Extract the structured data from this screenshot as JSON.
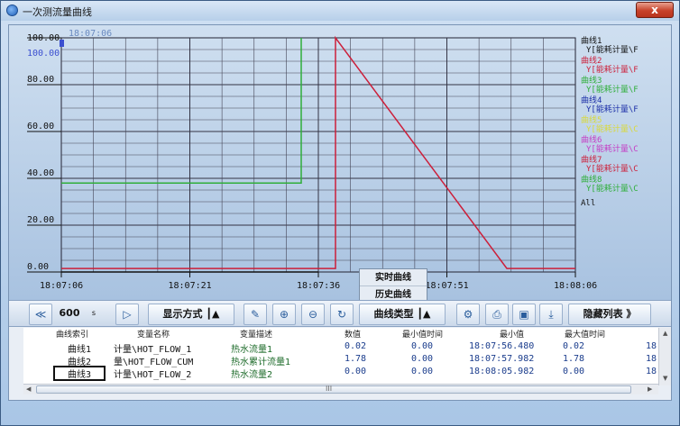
{
  "window": {
    "title": "一次测流量曲线",
    "close_label": "x"
  },
  "chart": {
    "y_ticks": [
      "100.00",
      "80.00",
      "60.00",
      "40.00",
      "20.00",
      "0.00"
    ],
    "y_max_label": "100.00",
    "cursor_time": "18:07:06",
    "x_ticks": [
      "18:07:06",
      "18:07:21",
      "18:07:36",
      "18:07:51",
      "18:08:06"
    ],
    "legend": [
      {
        "name": "曲线1",
        "var": "Y[能耗计量\\F",
        "color": "#111111"
      },
      {
        "name": "曲线2",
        "var": "Y[能耗计量\\F",
        "color": "#cc1f3a"
      },
      {
        "name": "曲线3",
        "var": "Y[能耗计量\\F",
        "color": "#2fae3a"
      },
      {
        "name": "曲线4",
        "var": "Y[能耗计量\\F",
        "color": "#1c2fa8"
      },
      {
        "name": "曲线5",
        "var": "Y[能耗计量\\C",
        "color": "#d9d93a"
      },
      {
        "name": "曲线6",
        "var": "Y[能耗计量\\C",
        "color": "#c43cc4"
      },
      {
        "name": "曲线7",
        "var": "Y[能耗计量\\C",
        "color": "#cc1f3a"
      },
      {
        "name": "曲线8",
        "var": "Y[能耗计量\\C",
        "color": "#2fae3a"
      }
    ],
    "legend_all": "All"
  },
  "chart_data": {
    "type": "line",
    "xlim": [
      "18:07:06",
      "18:08:06"
    ],
    "ylim": [
      0,
      100
    ],
    "grid": true,
    "legend_position": "right",
    "series": [
      {
        "name": "曲线1",
        "color": "#111111",
        "points": [
          [
            "18:07:06",
            0.02
          ],
          [
            "18:07:36",
            0.02
          ]
        ]
      },
      {
        "name": "曲线3",
        "color": "#2fae3a",
        "points": [
          [
            "18:07:06",
            38
          ],
          [
            "18:07:34",
            38
          ],
          [
            "18:07:34",
            100
          ]
        ]
      },
      {
        "name": "曲线2",
        "color": "#cc1f3a",
        "points": [
          [
            "18:07:06",
            1.5
          ],
          [
            "18:07:38",
            1.5
          ],
          [
            "18:07:38",
            100
          ],
          [
            "18:07:58",
            1.5
          ],
          [
            "18:08:06",
            1.5
          ]
        ]
      }
    ]
  },
  "popup": {
    "items": [
      "实时曲线",
      "历史曲线"
    ]
  },
  "toolbar": {
    "prev_icon": "≪",
    "count": "600",
    "count_unit": "s",
    "next_icon": "▷",
    "display_mode": "显示方式 ┃▲",
    "curve_type": "曲线类型 ┃▲",
    "hide_list": "隐藏列表 》"
  },
  "table": {
    "headers": [
      "曲线索引",
      "变量名称",
      "变量描述",
      "数值",
      "最小值时间",
      "最小值",
      "最大值时间"
    ],
    "rows": [
      {
        "idx": "曲线1",
        "var": "计量\\HOT_FLOW_1",
        "desc": "热水流量1",
        "value": "0.02",
        "min_time": "0.00",
        "min": "18:07:56.480",
        "max_time": "0.02",
        "extra": "18"
      },
      {
        "idx": "曲线2",
        "var": "量\\HOT_FLOW_CUM",
        "desc": "热水累计流量1",
        "value": "1.78",
        "min_time": "0.00",
        "min": "18:07:57.982",
        "max_time": "1.78",
        "extra": "18"
      },
      {
        "idx": "曲线3",
        "var": "计量\\HOT_FLOW_2",
        "desc": "热水流量2",
        "value": "0.00",
        "min_time": "0.00",
        "min": "18:08:05.982",
        "max_time": "0.00",
        "extra": "18"
      }
    ]
  },
  "scroll": {
    "h_label": "III"
  }
}
